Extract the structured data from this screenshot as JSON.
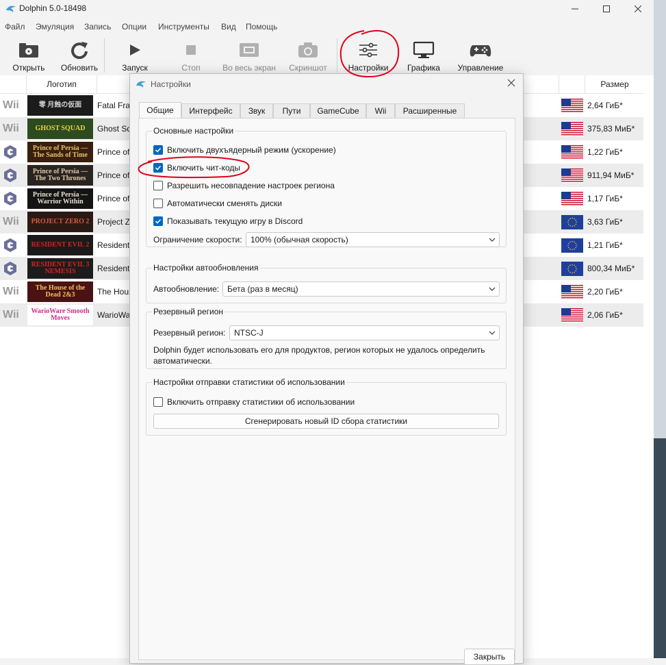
{
  "window": {
    "title": "Dolphin 5.0-18498"
  },
  "menu": [
    "Файл",
    "Эмуляция",
    "Запись",
    "Опции",
    "Инструменты",
    "Вид",
    "Помощь"
  ],
  "toolbar": {
    "open": "Открыть",
    "refresh": "Обновить",
    "play": "Запуск",
    "stop": "Стоп",
    "fullscreen": "Во весь экран",
    "screenshot": "Скриншот",
    "config": "Настройки",
    "graphics": "Графика",
    "controllers": "Управление"
  },
  "gamelist": {
    "col_logo": "Логотип",
    "col_size": "Размер",
    "rows": [
      {
        "platform": "Wii",
        "cover": "零 月蝕の仮面",
        "title": "Fatal Fran",
        "region": "us",
        "size": "2,64 ГиБ*"
      },
      {
        "platform": "Wii",
        "cover": "GHOST SQUAD",
        "title": "Ghost Sq",
        "region": "us",
        "size": "375,83 МиБ*"
      },
      {
        "platform": "GC",
        "cover": "Prince of Persia — The Sands of Time",
        "title": "Prince of",
        "region": "us",
        "size": "1,22 ГиБ*"
      },
      {
        "platform": "GC",
        "cover": "Prince of Persia — The Two Thrones",
        "title": "Prince of",
        "region": "us",
        "size": "911,94 МиБ*"
      },
      {
        "platform": "GC",
        "cover": "Prince of Persia — Warrior Within",
        "title": "Prince of",
        "region": "us",
        "size": "1,17 ГиБ*"
      },
      {
        "platform": "Wii",
        "cover": "PROJECT ZERO 2",
        "title": "Project Z",
        "region": "eu",
        "size": "3,63 ГиБ*"
      },
      {
        "platform": "GC",
        "cover": "RESIDENT EVIL 2",
        "title": "Resident",
        "region": "eu",
        "size": "1,21 ГиБ*"
      },
      {
        "platform": "GC",
        "cover": "RESIDENT EVIL 3 NEMESIS",
        "title": "Resident",
        "region": "eu",
        "size": "800,34 МиБ*"
      },
      {
        "platform": "Wii",
        "cover": "The House of the Dead 2&3",
        "title": "The Hous",
        "region": "us",
        "size": "2,20 ГиБ*"
      },
      {
        "platform": "Wii",
        "cover": "WarioWare Smooth Moves",
        "title": "WarioWa",
        "region": "us",
        "size": "2,06 ГиБ*"
      }
    ]
  },
  "dialog": {
    "title": "Настройки",
    "tabs": [
      "Общие",
      "Интерфейс",
      "Звук",
      "Пути",
      "GameCube",
      "Wii",
      "Расширенные"
    ],
    "active_tab": "Общие",
    "basic": {
      "title": "Основные настройки",
      "dual_core": "Включить двухъядерный режим (ускорение)",
      "cheats": "Включить чит-коды",
      "region_mismatch": "Разрешить несовпадение настроек региона",
      "auto_disc": "Автоматически сменять диски",
      "discord": "Показывать текущую игру в Discord",
      "speed_label": "Ограничение скорости:",
      "speed_value": "100% (обычная скорость)",
      "checked": {
        "dual_core": true,
        "cheats": true,
        "region_mismatch": false,
        "auto_disc": false,
        "discord": true
      }
    },
    "update": {
      "title": "Настройки автообновления",
      "label": "Автообновление:",
      "value": "Бета (раз в месяц)"
    },
    "fallback": {
      "title": "Резервный регион",
      "label": "Резервный регион:",
      "value": "NTSC-J",
      "desc": "Dolphin будет использовать его для продуктов, регион которых не удалось определить автоматически."
    },
    "stats": {
      "title": "Настройки отправки статистики об использовании",
      "enable": "Включить отправку статистики об использовании",
      "generate": "Сгенерировать новый ID сбора статистики",
      "checked": false
    },
    "close": "Закрыть"
  },
  "colors": {
    "accent": "#0067c0",
    "annotation": "#e0001a"
  }
}
